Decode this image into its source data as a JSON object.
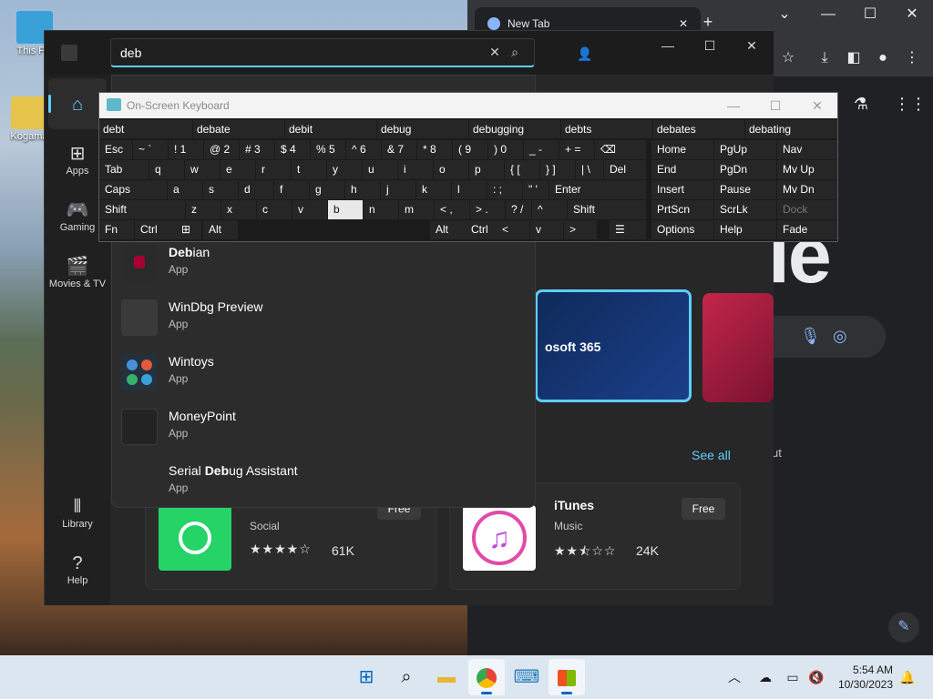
{
  "desktop": {
    "icons": [
      {
        "label": "This PC"
      },
      {
        "label": "Kogama"
      }
    ]
  },
  "chrome": {
    "tab_title": "New Tab",
    "new_tab": "+",
    "google_text": "le",
    "cut_text": "ut"
  },
  "store": {
    "search": {
      "value": "deb"
    },
    "nav": {
      "apps": "Apps",
      "gaming": "Gaming",
      "movies": "Movies & TV",
      "library": "Library",
      "help": "Help"
    },
    "hero_text": "osoft 365",
    "see_all": "See all",
    "cards": [
      {
        "name": "iTunes",
        "category": "Music",
        "rating": "24K",
        "button": "Free",
        "stars": 2.5
      },
      {
        "name": "",
        "category": "Social",
        "rating": "61K",
        "button": "Free",
        "stars": 4
      }
    ],
    "suggestions": [
      {
        "bold": "Deb",
        "rest": "ian",
        "type": "App"
      },
      {
        "bold": "",
        "rest": "WinDbg Preview",
        "type": "App"
      },
      {
        "bold": "",
        "rest": "Wintoys",
        "type": "App"
      },
      {
        "bold": "",
        "rest": "MoneyPoint",
        "type": "App"
      },
      {
        "prefix": "Serial ",
        "bold": "Deb",
        "rest": "ug Assistant",
        "type": "App"
      }
    ]
  },
  "osk": {
    "title": "On-Screen Keyboard",
    "predictions": [
      "debt",
      "debate",
      "debit",
      "debug",
      "debugging",
      "debts",
      "debates",
      "debating"
    ],
    "rows": [
      [
        "Esc",
        "~ `",
        "! 1",
        "@ 2",
        "# 3",
        "$ 4",
        "% 5",
        "^ 6",
        "& 7",
        "* 8",
        "( 9",
        ") 0",
        "_ -",
        "+ =",
        "⌫",
        "Home",
        "PgUp",
        "Nav"
      ],
      [
        "Tab",
        "q",
        "w",
        "e",
        "r",
        "t",
        "y",
        "u",
        "i",
        "o",
        "p",
        "{ [",
        "} ]",
        "| \\",
        "Del",
        "End",
        "PgDn",
        "Mv Up"
      ],
      [
        "Caps",
        "a",
        "s",
        "d",
        "f",
        "g",
        "h",
        "j",
        "k",
        "l",
        ": ;",
        "\" '",
        "Enter",
        "Insert",
        "Pause",
        "Mv Dn"
      ],
      [
        "Shift",
        "z",
        "x",
        "c",
        "v",
        "b",
        "n",
        "m",
        "< ,",
        "> .",
        "? /",
        "^",
        "Shift",
        "PrtScn",
        "ScrLk",
        "Dock"
      ],
      [
        "Fn",
        "Ctrl",
        "⊞",
        "Alt",
        "Alt",
        "Ctrl",
        "<",
        "v",
        ">",
        "☰",
        "Options",
        "Help",
        "Fade"
      ]
    ]
  },
  "taskbar": {
    "time": "5:54 AM",
    "date": "10/30/2023"
  },
  "colors": {
    "accent": "#60cdff",
    "store_bg": "#202020",
    "chrome_bg": "#202124"
  }
}
